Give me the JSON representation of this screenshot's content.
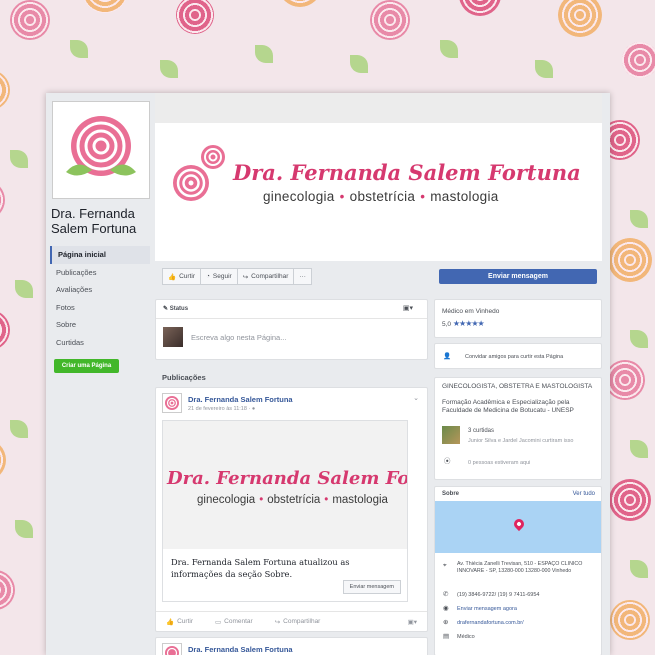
{
  "page": {
    "name_line1": "Dra. Fernanda",
    "name_line2": "Salem Fortuna"
  },
  "nav": [
    {
      "label": "Página inicial",
      "active": true
    },
    {
      "label": "Publicações",
      "active": false
    },
    {
      "label": "Avaliações",
      "active": false
    },
    {
      "label": "Fotos",
      "active": false
    },
    {
      "label": "Sobre",
      "active": false
    },
    {
      "label": "Curtidas",
      "active": false
    }
  ],
  "create_page_label": "Criar uma Página",
  "cover": {
    "title": "Dra. Fernanda Salem Fortuna",
    "sub1": "ginecologia",
    "sub2": "obstetrícia",
    "sub3": "mastologia",
    "dot": "•"
  },
  "actions": {
    "like": "Curtir",
    "follow": "Seguir",
    "share": "Compartilhar",
    "more": "···",
    "send_message": "Enviar mensagem"
  },
  "status": {
    "tab": "Status",
    "placeholder": "Escreva algo nesta Página..."
  },
  "publications_label": "Publicações",
  "post": {
    "author": "Dra. Fernanda Salem Fortuna",
    "date": "21 de fevereiro às 11:18 · ",
    "cover_title": "Dra. Fernanda Salem Fortuna",
    "text": "Dra. Fernanda Salem Fortuna atualizou as informações da seção Sobre.",
    "msg_button": "Enviar mensagem",
    "like": "Curtir",
    "comment": "Comentar",
    "share": "Compartilhar"
  },
  "post2_author": "Dra. Fernanda Salem Fortuna",
  "right": {
    "category": "Médico em Vinhedo",
    "rating": "5,0",
    "stars": "★★★★★",
    "invite": "Convidar amigos para curtir esta Página",
    "about_title": "GINECOLOGISTA, OBSTETRA E MASTOLOGISTA",
    "about_desc": "Formação Acadêmica e Especialização pela Faculdade de Medicina de Botucatu - UNESP",
    "likes_count": "3 curtidas",
    "likes_names": "Junior Silva e Jardel Jacomini curtiram isso",
    "checkins": "0 pessoas estiveram aqui",
    "sobre": "Sobre",
    "ver_tudo": "Ver tudo",
    "address": "Av. Thiécia Zanelli Trevisan, 510 - ESPAÇO CLINICO INNOVARE - SP, 13280-000 13280-000 Vinhedo",
    "phone": "(19) 3846-9722/ (19) 9 7411-6954",
    "send_msg_now": "Enviar mensagem agora",
    "website": "drafernandafortuna.com.br/",
    "category2": "Médico"
  },
  "colors": {
    "brand_pink": "#d6396f",
    "fb_blue": "#4267b2",
    "green": "#42b72a"
  }
}
